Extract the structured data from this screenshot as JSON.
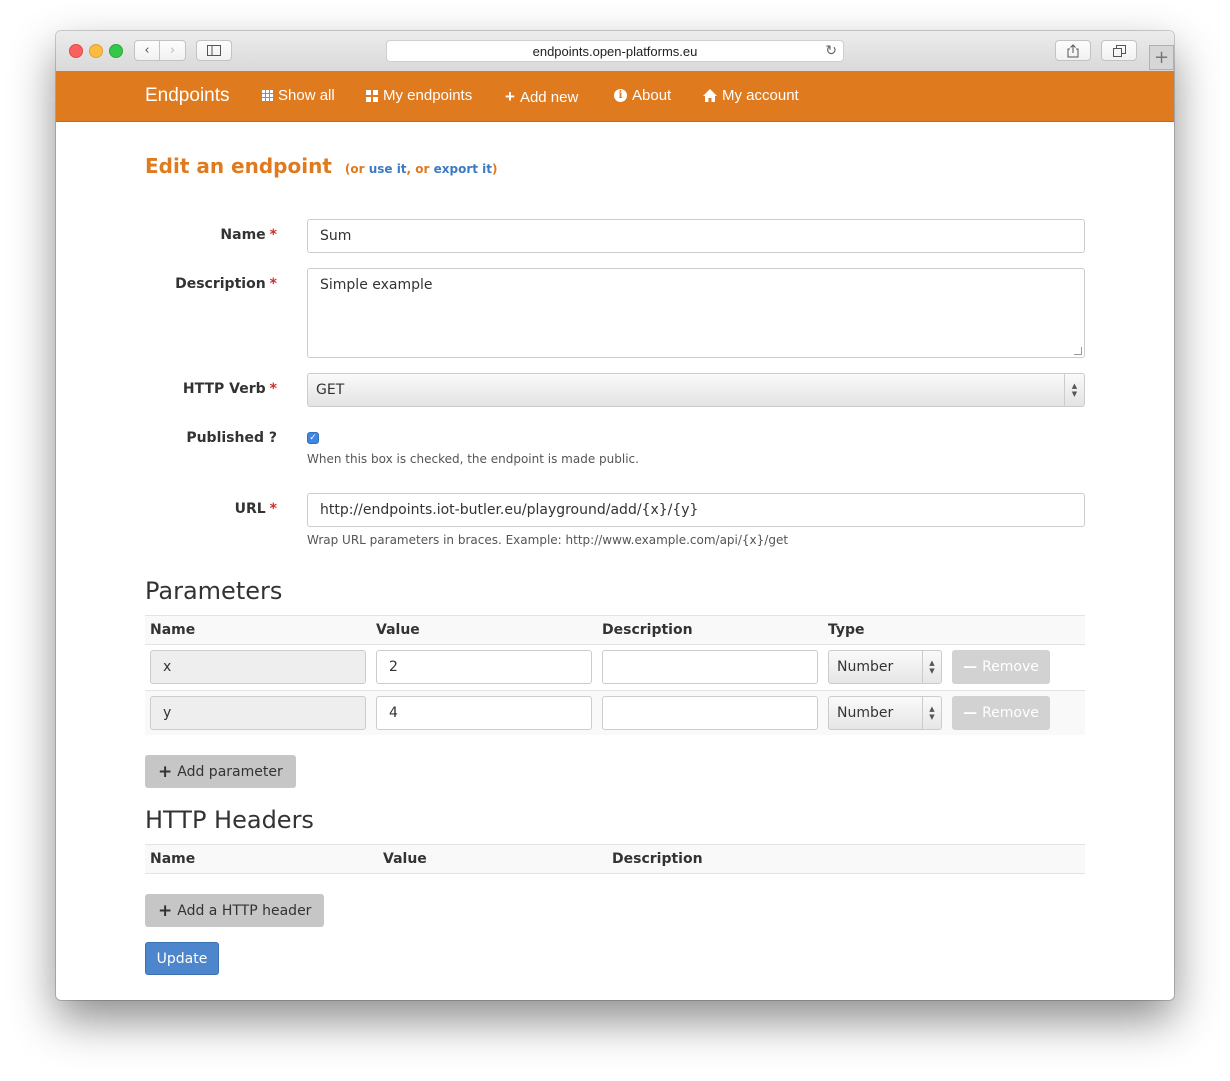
{
  "browser": {
    "url": "endpoints.open-platforms.eu",
    "newtab_symbol": "+"
  },
  "navbar": {
    "brand": "Endpoints",
    "items": [
      {
        "label": "Show all",
        "icon": "th-grid-icon"
      },
      {
        "label": "My endpoints",
        "icon": "th-large-icon"
      },
      {
        "label": "Add new",
        "icon": "plus-icon"
      },
      {
        "label": "About",
        "icon": "info-circle-icon"
      },
      {
        "label": "My account",
        "icon": "home-icon"
      }
    ],
    "color": "#e07a1f"
  },
  "page": {
    "title": "Edit an endpoint",
    "title_suffix_open": "(or ",
    "use_link": "use it",
    "title_suffix_mid": ", or ",
    "export_link": "export it",
    "title_suffix_close": ")"
  },
  "form": {
    "name_label": "Name",
    "name_value": "Sum",
    "description_label": "Description",
    "description_value": "Simple example",
    "verb_label": "HTTP Verb",
    "verb_value": "GET",
    "published_label": "Published ?",
    "published_checked": true,
    "published_help": "When this box is checked, the endpoint is made public.",
    "url_label": "URL",
    "url_value": "http://endpoints.iot-butler.eu/playground/add/{x}/{y}",
    "url_help": "Wrap URL parameters in braces. Example: http://www.example.com/api/{x}/get",
    "required_mark": "*"
  },
  "parameters": {
    "heading": "Parameters",
    "columns": [
      "Name",
      "Value",
      "Description",
      "Type"
    ],
    "rows": [
      {
        "name": "x",
        "value": "2",
        "description": "",
        "type": "Number",
        "remove_label": "Remove"
      },
      {
        "name": "y",
        "value": "4",
        "description": "",
        "type": "Number",
        "remove_label": "Remove"
      }
    ],
    "add_label": "Add parameter"
  },
  "headers": {
    "heading": "HTTP Headers",
    "columns": [
      "Name",
      "Value",
      "Description"
    ],
    "add_label": "Add a HTTP header"
  },
  "update_label": "Update"
}
